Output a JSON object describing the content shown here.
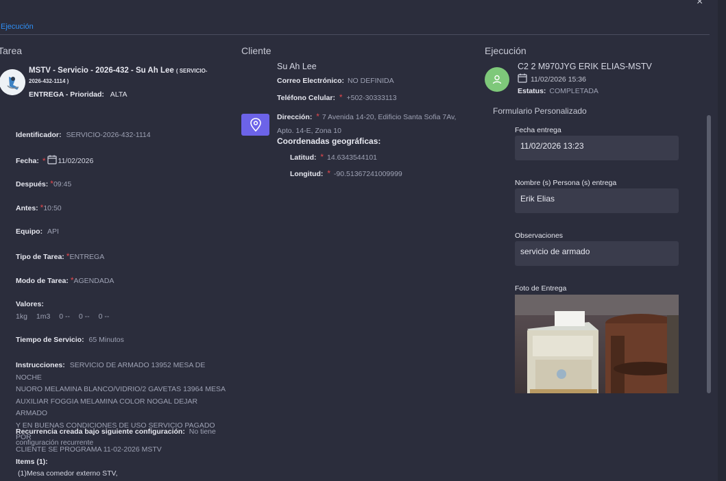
{
  "window": {
    "close_label": "×"
  },
  "tabs": [
    {
      "label": "Ejecución"
    }
  ],
  "tarea": {
    "section_title": "Tarea",
    "title": "MSTV - Servicio - 2026-432 - Su Ah Lee",
    "code": "( SERVICIO-2026-432-1114 )",
    "type_line_label": "ENTREGA - Prioridad:",
    "priority": "ALTA",
    "fields": {
      "identificador": {
        "label": "Identificador:",
        "value": "SERVICIO-2026-432-1114"
      },
      "fecha": {
        "label": "Fecha:",
        "value": "11/02/2026"
      },
      "despues": {
        "label": "Después:",
        "value": "09:45"
      },
      "antes": {
        "label": "Antes:",
        "value": "10:50"
      },
      "equipo": {
        "label": "Equipo:",
        "value": "API"
      },
      "tipo_tarea": {
        "label": "Tipo de Tarea:",
        "value": "ENTREGA"
      },
      "modo_tarea": {
        "label": "Modo de Tarea:",
        "value": "AGENDADA"
      },
      "valores": {
        "label": "Valores:",
        "items": [
          "1kg",
          "1m3",
          "0 --",
          "0 --",
          "0 --"
        ]
      },
      "tiempo_servicio": {
        "label": "Tiempo de Servicio:",
        "value": "65 Minutos"
      },
      "instrucciones": {
        "label": "Instrucciones:",
        "lines": [
          "SERVICIO DE ARMADO 13952 MESA DE NOCHE",
          "NUORO MELAMINA BLANCO/VIDRIO/2 GAVETAS 13964 MESA",
          "AUXILIAR FOGGIA MELAMINA COLOR NOGAL DEJAR ARMADO",
          "Y EN BUENAS CONDICIONES DE USO SERVICIO PAGADO POR",
          "CLIENTE SE PROGRAMA 11-02-2026 MSTV"
        ]
      },
      "recurrencia": {
        "label": "Recurrencia creada bajo siguiente configuración:",
        "value_a": "No tiene",
        "value_b": "configuración recurrente"
      },
      "items": {
        "label": "Items (1):",
        "value": "(1)Mesa comedor externo STV,"
      }
    }
  },
  "cliente": {
    "section_title": "Cliente",
    "name": "Su Ah Lee",
    "correo": {
      "label": "Correo Electrónico:",
      "value": "NO DEFINIDA"
    },
    "telefono": {
      "label": "Teléfono Celular:",
      "value": "+502-30333113"
    },
    "direccion": {
      "label": "Dirección:",
      "value_a": "7 Avenida 14-20, Edificio Santa Sofia 7Av,",
      "value_b": "Apto. 14-E, Zona 10"
    },
    "coordenadas_title": "Coordenadas geográficas:",
    "latitud": {
      "label": "Latitud:",
      "value": "14.6343544101"
    },
    "longitud": {
      "label": "Longitud:",
      "value": "-90.51367241009999"
    }
  },
  "ejecucion": {
    "section_title": "Ejecución",
    "driver": "C2 2 M970JYG ERIK ELIAS-MSTV",
    "datetime": "11/02/2026 15:36",
    "estatus_label": "Estatus:",
    "estatus_value": "COMPLETADA",
    "form_title": "Formulario Personalizado",
    "fields": [
      {
        "label": "Fecha entrega",
        "value": "11/02/2026 13:23"
      },
      {
        "label": "Nombre (s) Persona (s) entrega",
        "value": "Erik Elias"
      },
      {
        "label": "Observaciones",
        "value": "servicio de armado"
      }
    ],
    "photo_label": "Foto de Entrega"
  },
  "colors": {
    "accent": "#2f8ff5",
    "map_button": "#6c63e8",
    "avatar": "#7ec87a",
    "required": "#e5484d"
  },
  "icons": [
    "close-icon",
    "calendar-icon",
    "map-pin-icon",
    "user-icon"
  ]
}
